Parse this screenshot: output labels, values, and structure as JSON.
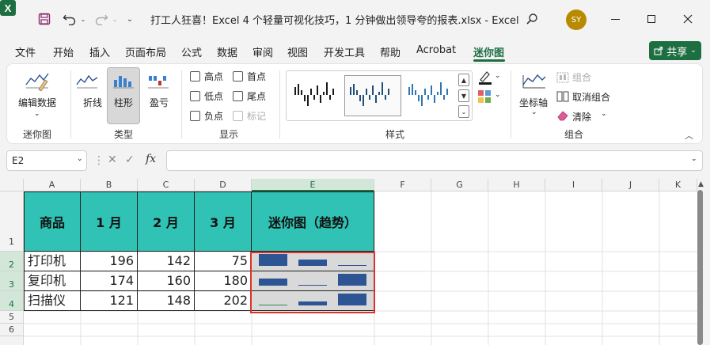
{
  "window": {
    "title": "打工人狂喜！Excel 4 个轻量可视化技巧，1 分钟做出领导夸的报表.xlsx  -  Excel",
    "avatar_initials": "SY",
    "app_icon": "excel-icon"
  },
  "menu": {
    "tabs": [
      "文件",
      "开始",
      "插入",
      "页面布局",
      "公式",
      "数据",
      "审阅",
      "视图",
      "开发工具",
      "帮助",
      "Acrobat",
      "迷你图"
    ],
    "active_tab": "迷你图",
    "share_label": "共享"
  },
  "ribbon": {
    "sparkline_group": {
      "edit_data_label": "编辑数据",
      "group_label": "迷你图"
    },
    "type_group": {
      "line_label": "折线",
      "column_label": "柱形",
      "winloss_label": "盈亏",
      "group_label": "类型",
      "active": "柱形"
    },
    "show_group": {
      "group_label": "显示",
      "options": [
        {
          "label": "高点",
          "checked": false,
          "enabled": true
        },
        {
          "label": "首点",
          "checked": false,
          "enabled": true
        },
        {
          "label": "低点",
          "checked": false,
          "enabled": true
        },
        {
          "label": "尾点",
          "checked": false,
          "enabled": true
        },
        {
          "label": "负点",
          "checked": false,
          "enabled": true
        },
        {
          "label": "标记",
          "checked": false,
          "enabled": false
        }
      ]
    },
    "style_group": {
      "group_label": "样式"
    },
    "group_group": {
      "group_label": "组合",
      "axis_label": "坐标轴",
      "group_btn_label": "组合",
      "ungroup_label": "取消组合",
      "clear_label": "清除"
    }
  },
  "formula_bar": {
    "name_box": "E2",
    "fx": "fx",
    "formula": ""
  },
  "sheet": {
    "columns": [
      "A",
      "B",
      "C",
      "D",
      "E",
      "F",
      "G",
      "H",
      "I",
      "J",
      "K"
    ],
    "selected_column": "E",
    "rows": [
      "1",
      "2",
      "3",
      "4",
      "5",
      "6"
    ],
    "header": [
      "商品",
      "1  月",
      "2  月",
      "3  月",
      "迷你图（趋势）"
    ],
    "data": [
      {
        "name": "打印机",
        "m1": "196",
        "m2": "142",
        "m3": "75"
      },
      {
        "name": "复印机",
        "m1": "174",
        "m2": "160",
        "m3": "180"
      },
      {
        "name": "扫描仪",
        "m1": "121",
        "m2": "148",
        "m3": "202"
      }
    ]
  },
  "colors": {
    "header_fill": "#30c2b4",
    "spark_bar": "#2d5593",
    "accent": "#1d6f42",
    "selection": "#d9342b"
  }
}
